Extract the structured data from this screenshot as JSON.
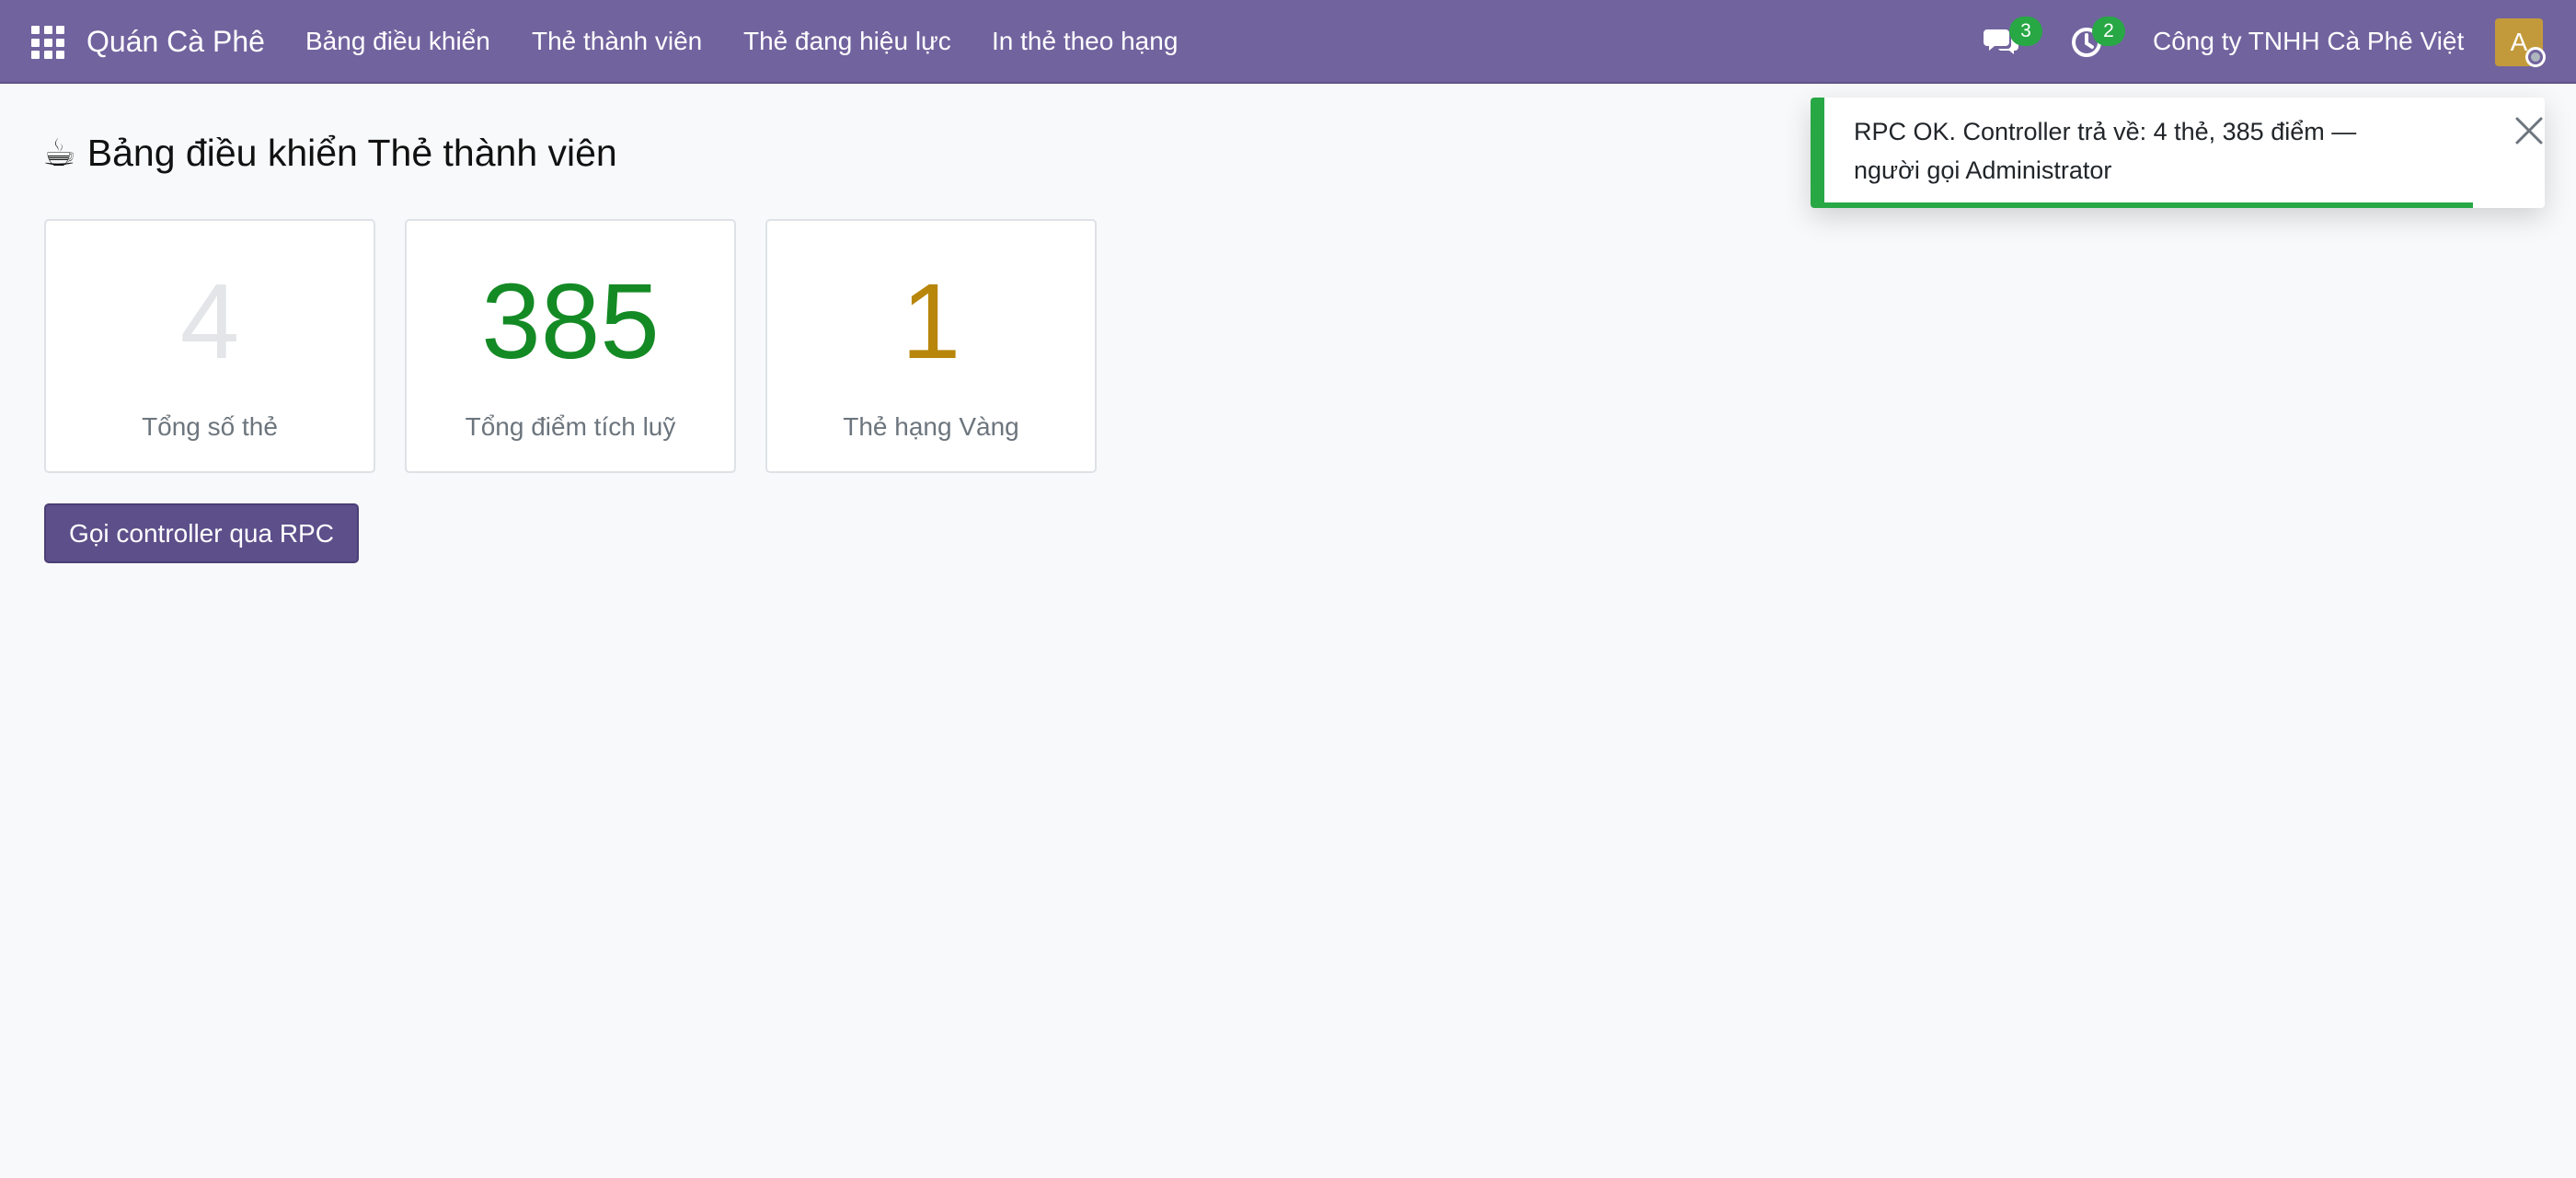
{
  "navbar": {
    "brand": "Quán Cà Phê",
    "menu": [
      {
        "label": "Bảng điều khiển"
      },
      {
        "label": "Thẻ thành viên"
      },
      {
        "label": "Thẻ đang hiệu lực"
      },
      {
        "label": "In thẻ theo hạng"
      }
    ],
    "messages_badge": "3",
    "activities_badge": "2",
    "company": "Công ty TNHH Cà Phê Việt",
    "avatar_letter": "A"
  },
  "page": {
    "title_icon": "☕",
    "title": "Bảng điều khiển Thẻ thành viên"
  },
  "stats": [
    {
      "value": "4",
      "label": "Tổng số thẻ",
      "color": "#e3e5e8"
    },
    {
      "value": "385",
      "label": "Tổng điểm tích luỹ",
      "color": "#148a25"
    },
    {
      "value": "1",
      "label": "Thẻ hạng Vàng",
      "color": "#b8860b"
    }
  ],
  "actions": {
    "rpc_button_label": "Gọi controller qua RPC"
  },
  "toast": {
    "message": "RPC OK. Controller trả về: 4 thẻ, 385 điểm — người gọi Administrator",
    "progress": 0.9,
    "accent_color": "#28a745"
  },
  "colors": {
    "navbar": "#71639e",
    "primary_button": "#5c4f8a",
    "badge": "#28a745"
  }
}
